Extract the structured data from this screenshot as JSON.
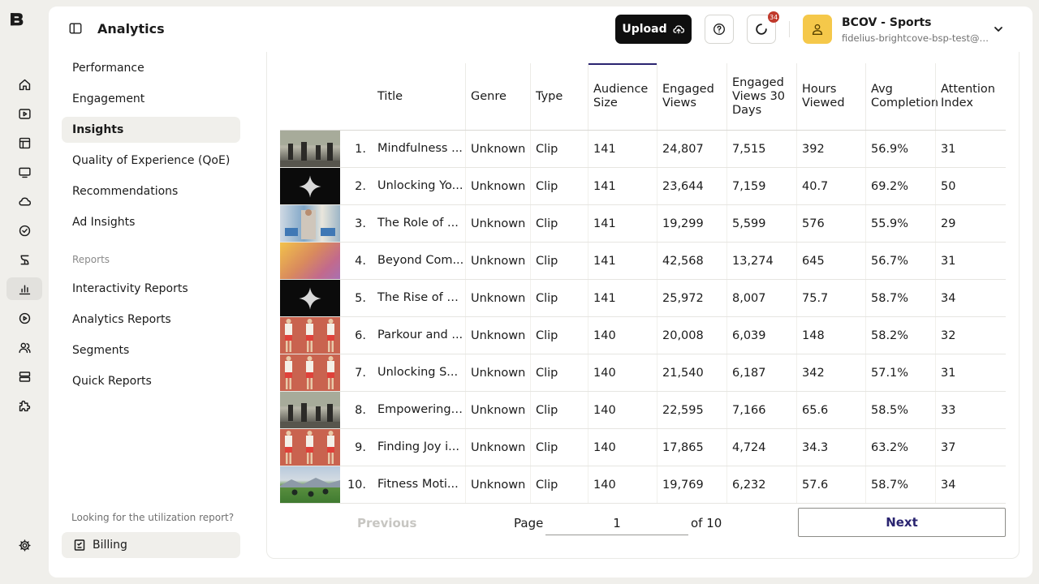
{
  "header": {
    "title": "Analytics",
    "upload_label": "Upload",
    "notification_count": "34",
    "account_name": "BCOV - Sports",
    "account_email": "fidelius-brightcove-bsp-test@b..."
  },
  "rail": {
    "icons": [
      "home-icon",
      "video-icon",
      "playlist-icon",
      "player-icon",
      "cloud-icon",
      "check-circle-icon",
      "social-icon",
      "analytics-icon",
      "live-icon",
      "users-icon",
      "server-icon",
      "plugin-icon",
      "settings-icon"
    ],
    "active": "analytics-icon"
  },
  "nav": {
    "items": [
      "Performance",
      "Engagement",
      "Insights",
      "Quality of Experience (QoE)",
      "Recommendations",
      "Ad Insights"
    ],
    "active": "Insights",
    "reports_heading": "Reports",
    "report_items": [
      "Interactivity Reports",
      "Analytics Reports",
      "Segments",
      "Quick Reports"
    ],
    "utilization_text": "Looking for the utilization report?",
    "billing_label": "Billing"
  },
  "table": {
    "columns": [
      "Title",
      "Genre",
      "Type",
      "Audience Size",
      "Engaged Views",
      "Engaged Views 30 Days",
      "Hours Viewed",
      "Avg Completion",
      "Attention Index"
    ],
    "sorted_column": "Audience Size",
    "rows": [
      {
        "thumb": "park",
        "rank": "1.",
        "title": "Mindfulness ...",
        "genre": "Unknown",
        "type": "Clip",
        "audience": "141",
        "views": "24,807",
        "views30": "7,515",
        "hours": "392",
        "completion": "56.9%",
        "attention": "31"
      },
      {
        "thumb": "star",
        "rank": "2.",
        "title": "Unlocking Yo...",
        "genre": "Unknown",
        "type": "Clip",
        "audience": "141",
        "views": "23,644",
        "views30": "7,159",
        "hours": "40.7",
        "completion": "69.2%",
        "attention": "50"
      },
      {
        "thumb": "gym",
        "rank": "3.",
        "title": "The Role of ...",
        "genre": "Unknown",
        "type": "Clip",
        "audience": "141",
        "views": "19,299",
        "views30": "5,599",
        "hours": "576",
        "completion": "55.9%",
        "attention": "29"
      },
      {
        "thumb": "gradient",
        "rank": "4.",
        "title": "Beyond Com...",
        "genre": "Unknown",
        "type": "Clip",
        "audience": "141",
        "views": "42,568",
        "views30": "13,274",
        "hours": "645",
        "completion": "56.7%",
        "attention": "31"
      },
      {
        "thumb": "star",
        "rank": "5.",
        "title": "The Rise of e...",
        "genre": "Unknown",
        "type": "Clip",
        "audience": "141",
        "views": "25,972",
        "views30": "8,007",
        "hours": "75.7",
        "completion": "58.7%",
        "attention": "34"
      },
      {
        "thumb": "track",
        "rank": "6.",
        "title": "Parkour and ...",
        "genre": "Unknown",
        "type": "Clip",
        "audience": "140",
        "views": "20,008",
        "views30": "6,039",
        "hours": "148",
        "completion": "58.2%",
        "attention": "32"
      },
      {
        "thumb": "track",
        "rank": "7.",
        "title": "Unlocking S...",
        "genre": "Unknown",
        "type": "Clip",
        "audience": "140",
        "views": "21,540",
        "views30": "6,187",
        "hours": "342",
        "completion": "57.1%",
        "attention": "31"
      },
      {
        "thumb": "park",
        "rank": "8.",
        "title": "Empowering ...",
        "genre": "Unknown",
        "type": "Clip",
        "audience": "140",
        "views": "22,595",
        "views30": "7,166",
        "hours": "65.6",
        "completion": "58.5%",
        "attention": "33"
      },
      {
        "thumb": "track",
        "rank": "9.",
        "title": "Finding Joy i...",
        "genre": "Unknown",
        "type": "Clip",
        "audience": "140",
        "views": "17,865",
        "views30": "4,724",
        "hours": "34.3",
        "completion": "63.2%",
        "attention": "37"
      },
      {
        "thumb": "field",
        "rank": "10.",
        "title": "Fitness Moti...",
        "genre": "Unknown",
        "type": "Clip",
        "audience": "140",
        "views": "19,769",
        "views30": "6,232",
        "hours": "57.6",
        "completion": "58.7%",
        "attention": "34"
      }
    ]
  },
  "pagination": {
    "previous_label": "Previous",
    "page_label": "Page",
    "current_page": "1",
    "of_label": "of 10",
    "next_label": "Next"
  }
}
